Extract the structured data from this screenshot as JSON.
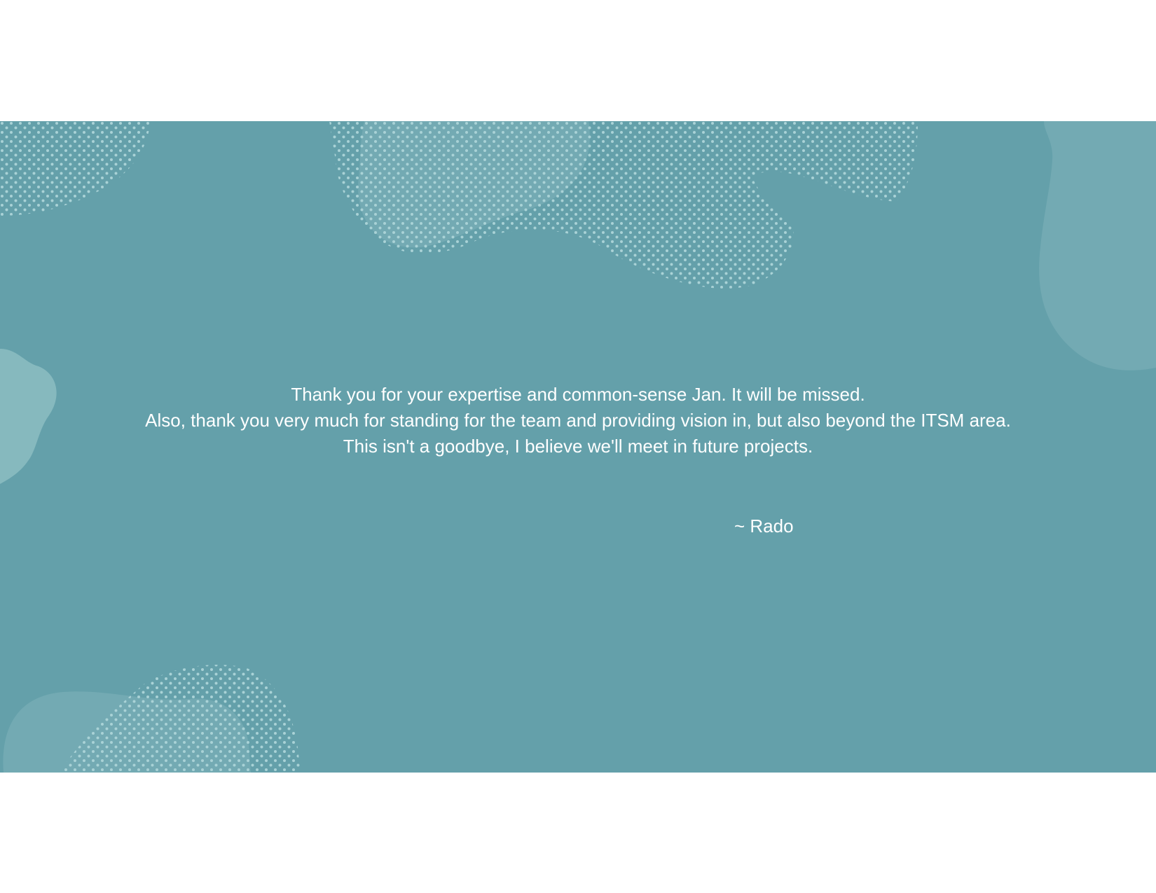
{
  "slide": {
    "background_color": "#64a0aa",
    "blob_color": "#74abb4",
    "dot_color": "#a9d2d6",
    "message_lines": [
      "Thank you for your expertise and common-sense Jan. It will be missed.",
      "Also, thank you very much for standing for the team and providing vision in, but also beyond the ITSM area.",
      "This isn't a goodbye, I believe we'll meet in future projects."
    ],
    "signature": "~ Rado"
  }
}
